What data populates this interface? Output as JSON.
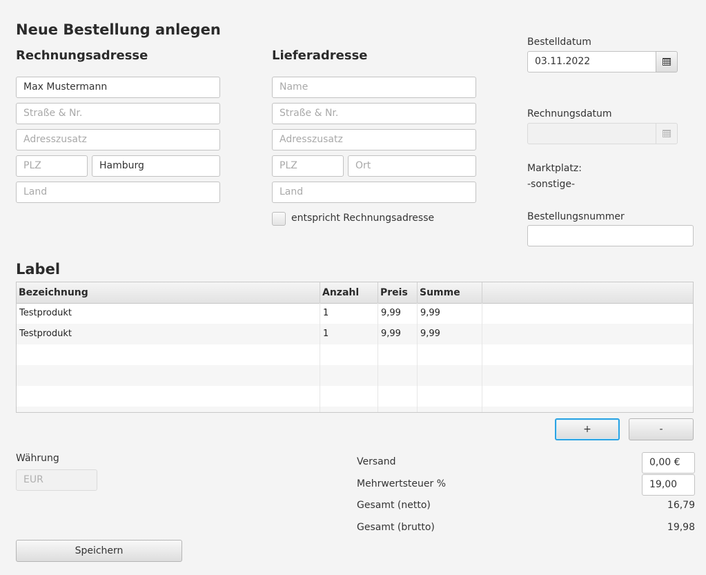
{
  "title": "Neue Bestellung anlegen",
  "billing": {
    "heading": "Rechnungsadresse",
    "name": {
      "value": "Max Mustermann",
      "placeholder": "Name"
    },
    "street": {
      "value": "",
      "placeholder": "Straße & Nr."
    },
    "extra": {
      "value": "",
      "placeholder": "Adresszusatz"
    },
    "zip": {
      "value": "",
      "placeholder": "PLZ"
    },
    "city": {
      "value": "Hamburg",
      "placeholder": "Ort"
    },
    "country": {
      "value": "",
      "placeholder": "Land"
    }
  },
  "shipping": {
    "heading": "Lieferadresse",
    "name": {
      "value": "",
      "placeholder": "Name"
    },
    "street": {
      "value": "",
      "placeholder": "Straße & Nr."
    },
    "extra": {
      "value": "",
      "placeholder": "Adresszusatz"
    },
    "zip": {
      "value": "",
      "placeholder": "PLZ"
    },
    "city": {
      "value": "",
      "placeholder": "Ort"
    },
    "country": {
      "value": "",
      "placeholder": "Land"
    },
    "same_as_billing_label": "entspricht Rechnungsadresse",
    "same_as_billing_checked": false
  },
  "order_date": {
    "label": "Bestelldatum",
    "value": "03.11.2022"
  },
  "invoice_date": {
    "label": "Rechnungsdatum",
    "value": ""
  },
  "marketplace": {
    "label": "Marktplatz:",
    "value": "-sonstige-"
  },
  "order_number": {
    "label": "Bestellungsnummer",
    "value": ""
  },
  "items_section_label": "Label",
  "table": {
    "columns": [
      "Bezeichnung",
      "Anzahl",
      "Preis",
      "Summe"
    ],
    "rows": [
      [
        "Testprodukt",
        "1",
        "9,99",
        "9,99"
      ],
      [
        "Testprodukt",
        "1",
        "9,99",
        "9,99"
      ]
    ]
  },
  "buttons": {
    "add": "+",
    "remove": "-",
    "save": "Speichern"
  },
  "currency": {
    "label": "Währung",
    "value": "EUR"
  },
  "totals": {
    "shipping_label": "Versand",
    "shipping_value": "0,00 €",
    "vat_label": "Mehrwertsteuer %",
    "vat_value": "19,00",
    "net_label": "Gesamt (netto)",
    "net_value": "16,79",
    "gross_label": "Gesamt (brutto)",
    "gross_value": "19,98"
  },
  "icons": {
    "date_picker": "calendar-icon"
  },
  "colors": {
    "focus": "#2aa3e3",
    "background": "#f4f4f4"
  }
}
